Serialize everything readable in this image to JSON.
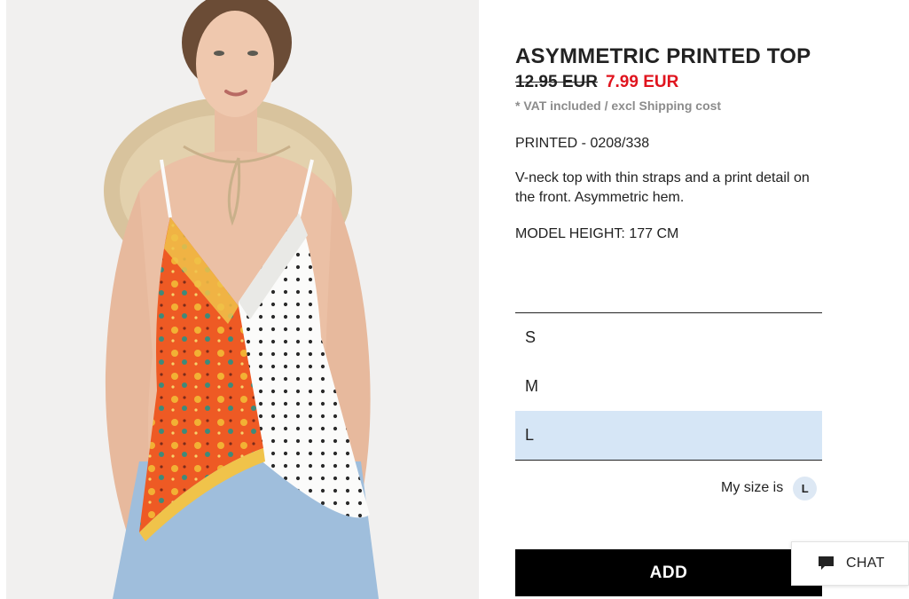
{
  "product": {
    "image_alt": "Model wearing asymmetric printed top",
    "title": "ASYMMETRIC PRINTED TOP",
    "old_price": "12.95 EUR",
    "new_price": "7.99 EUR",
    "vat_note": "* VAT included / excl Shipping cost",
    "reference": "PRINTED - 0208/338",
    "description": "V-neck top with thin straps and a print detail on the front. Asymmetric hem.",
    "model_height": "MODEL HEIGHT: 177 CM"
  },
  "sizes": {
    "options": [
      "S",
      "M",
      "L"
    ],
    "selected": "L"
  },
  "my_size": {
    "label": "My size is",
    "value": "L"
  },
  "actions": {
    "add_label": "ADD"
  },
  "chat": {
    "label": "CHAT",
    "icon": "chat-bubble-icon"
  },
  "colors": {
    "sale_price": "#e0141e",
    "selected_size_bg": "#d6e6f6",
    "add_button_bg": "#000000",
    "muted_text": "#8c8c8c"
  }
}
